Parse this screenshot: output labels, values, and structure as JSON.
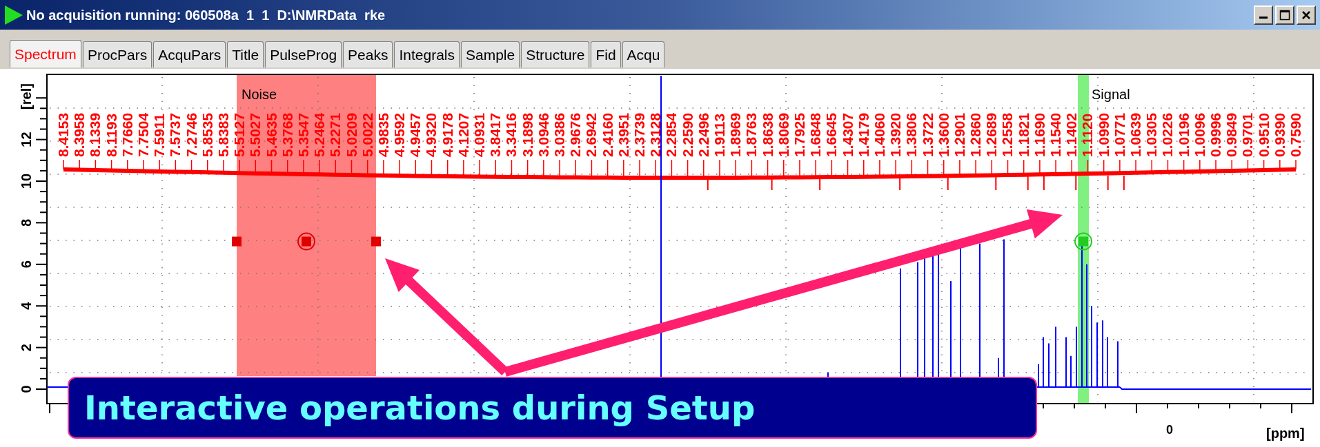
{
  "window": {
    "title": "No acquisition running: 060508a  1  1  D:\\NMRData  rke"
  },
  "tabs": [
    {
      "label": "Spectrum",
      "selected": true
    },
    {
      "label": "ProcPars",
      "selected": false
    },
    {
      "label": "AcquPars",
      "selected": false
    },
    {
      "label": "Title",
      "selected": false
    },
    {
      "label": "PulseProg",
      "selected": false
    },
    {
      "label": "Peaks",
      "selected": false
    },
    {
      "label": "Integrals",
      "selected": false
    },
    {
      "label": "Sample",
      "selected": false
    },
    {
      "label": "Structure",
      "selected": false
    },
    {
      "label": "Fid",
      "selected": false
    },
    {
      "label": "Acqu",
      "selected": false
    }
  ],
  "plot": {
    "y_axis": {
      "unit": "[rel]",
      "ticks": [
        "0",
        "2",
        "4",
        "6",
        "8",
        "10",
        "12"
      ]
    },
    "x_axis": {
      "ticks": [
        "0"
      ],
      "unit": "[ppm]"
    },
    "peak_labels": [
      "8.4153",
      "8.3958",
      "8.1339",
      "8.1193",
      "7.7660",
      "7.7504",
      "7.5911",
      "7.5737",
      "7.2746",
      "5.8535",
      "5.8383",
      "5.5127",
      "5.5027",
      "5.4635",
      "5.3768",
      "5.3547",
      "5.2464",
      "5.2271",
      "5.0209",
      "5.0022",
      "4.9835",
      "4.9592",
      "4.9457",
      "4.9320",
      "4.9178",
      "4.1207",
      "4.0931",
      "3.8417",
      "3.3416",
      "3.1898",
      "3.0946",
      "3.0386",
      "2.9676",
      "2.6942",
      "2.4160",
      "2.3951",
      "2.3739",
      "2.3128",
      "2.2854",
      "2.2590",
      "2.2496",
      "1.9113",
      "1.8969",
      "1.8763",
      "1.8638",
      "1.8069",
      "1.7925",
      "1.6848",
      "1.6645",
      "1.4307",
      "1.4179",
      "1.4060",
      "1.3920",
      "1.3806",
      "1.3722",
      "1.3600",
      "1.2901",
      "1.2860",
      "1.2689",
      "1.2558",
      "1.1821",
      "1.1690",
      "1.1540",
      "1.1402",
      "1.1120",
      "1.0990",
      "1.0771",
      "1.0639",
      "1.0305",
      "1.0226",
      "1.0196",
      "1.0096",
      "0.9996",
      "0.9849",
      "0.9701",
      "0.9510",
      "0.9390",
      "0.7590"
    ],
    "regions": [
      {
        "label": "Noise",
        "kind": "noise"
      },
      {
        "label": "Signal",
        "kind": "signal"
      }
    ]
  },
  "banner": {
    "text": "Interactive operations during Setup"
  }
}
